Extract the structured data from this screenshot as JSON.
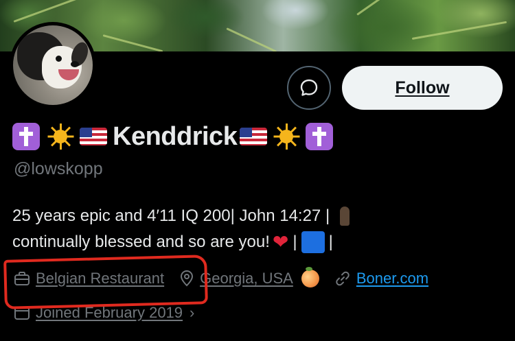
{
  "profile": {
    "display_name": "Kenddrick",
    "handle": "@lowskopp",
    "follow_label": "Follow",
    "bio_line1": "25 years epic and 4′11 IQ 200| John 14:27 |",
    "bio_line2_text": "continually blessed and so are you!",
    "bio_sep": "|"
  },
  "meta": {
    "category": "Belgian Restaurant",
    "location": "Georgia, USA",
    "website": "Boner.com",
    "joined": "Joined February 2019",
    "joined_chevron": "›"
  },
  "icons": {
    "message": "message-bubble-icon",
    "category": "briefcase-icon",
    "location": "location-pin-icon",
    "website": "link-icon",
    "joined": "calendar-icon"
  },
  "colors": {
    "accent_link": "#1d9bf0",
    "muted": "#71767b",
    "annotation": "#e02a1f",
    "follow_bg": "#eff3f4"
  }
}
